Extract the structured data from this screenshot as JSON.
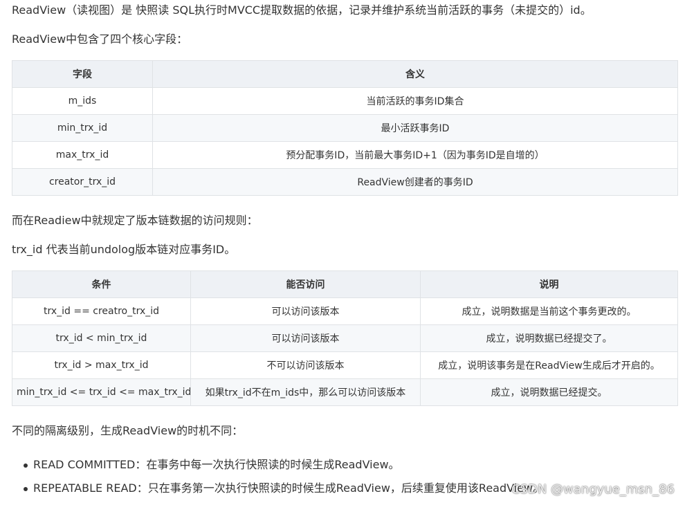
{
  "intro": {
    "line1": "ReadView（读视图）是 快照读 SQL执行时MVCC提取数据的依据，记录并维护系统当前活跃的事务（未提交的）id。",
    "line2": "ReadView中包含了四个核心字段："
  },
  "fields_table": {
    "headers": [
      "字段",
      "含义"
    ],
    "rows": [
      [
        "m_ids",
        "当前活跃的事务ID集合"
      ],
      [
        "min_trx_id",
        "最小活跃事务ID"
      ],
      [
        "max_trx_id",
        "预分配事务ID，当前最大事务ID+1（因为事务ID是自增的）"
      ],
      [
        "creator_trx_id",
        "ReadView创建者的事务ID"
      ]
    ]
  },
  "rules": {
    "line1": "而在Readiew中就规定了版本链数据的访问规则：",
    "line2": "trx_id 代表当前undolog版本链对应事务ID。"
  },
  "rules_table": {
    "headers": [
      "条件",
      "能否访问",
      "说明"
    ],
    "rows": [
      [
        "trx_id == creatro_trx_id",
        "可以访问该版本",
        "成立，说明数据是当前这个事务更改的。"
      ],
      [
        "trx_id < min_trx_id",
        "可以访问该版本",
        "成立，说明数据已经提交了。"
      ],
      [
        "trx_id > max_trx_id",
        "不可以访问该版本",
        "成立，说明该事务是在ReadView生成后才开启的。"
      ],
      [
        "min_trx_id <= trx_id <= max_trx_id",
        "如果trx_id不在m_ids中，那么可以访问该版本",
        "成立，说明数据已经提交。"
      ]
    ]
  },
  "isolation": {
    "intro": "不同的隔离级别，生成ReadView的时机不同：",
    "items": [
      "READ COMMITTED：在事务中每一次执行快照读的时候生成ReadView。",
      "REPEATABLE READ：只在事务第一次执行快照读的时候生成ReadView，后续重复使用该ReadView。"
    ]
  },
  "watermark": "CSDN @wangyue_msn_86"
}
